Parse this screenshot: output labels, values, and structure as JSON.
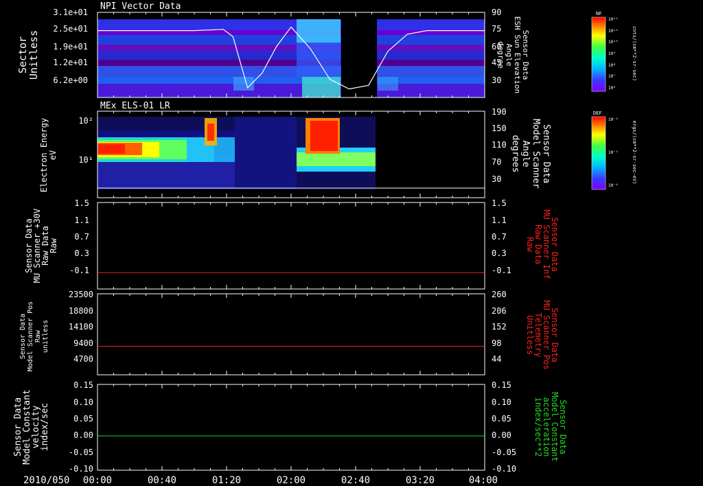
{
  "time_axis": {
    "date_label": "2010/050",
    "tick_labels": [
      "00:00",
      "00:40",
      "01:20",
      "02:00",
      "02:40",
      "03:20",
      "04:00"
    ],
    "range_hours": [
      0,
      4
    ],
    "data_gap_hours": [
      2.42,
      2.78
    ]
  },
  "colors": {
    "background": "#000000",
    "axis": "#ffffff",
    "red_trace": "#ff2020",
    "green_trace": "#22dd22"
  },
  "chart_data": [
    {
      "id": "npi",
      "type": "heatmap",
      "title": "NPI Vector Data",
      "ylabel_left": [
        "Sector",
        "Unitless"
      ],
      "ylabel_right": [
        "Sensor Data",
        "ESH Sun Elevation",
        "Angle",
        "degree"
      ],
      "y_ticks_left": [
        "3.1e+01",
        "2.5e+01",
        "1.9e+01",
        "1.2e+01",
        "6.2e+00"
      ],
      "y_ticks_right": [
        "90",
        "75",
        "60",
        "45",
        "30"
      ],
      "y_range_right": [
        20,
        90
      ],
      "colorbar": {
        "label": "NF",
        "units": "cnts/(cm**2-sr-sec)",
        "ticks": [
          "10¹²",
          "10¹¹",
          "10¹⁰",
          "10⁹",
          "10⁸",
          "10⁷",
          "10⁶"
        ]
      },
      "overlay_series": {
        "name": "",
        "x": [
          0,
          0.5,
          1.0,
          1.3,
          1.4,
          1.55,
          1.7,
          1.85,
          2.0,
          2.2,
          2.4,
          2.6,
          2.8,
          3.0,
          3.2,
          3.4,
          4.0
        ],
        "y": [
          75,
          75,
          75,
          76,
          70,
          28,
          40,
          62,
          78,
          60,
          35,
          27,
          30,
          58,
          72,
          75,
          75
        ]
      }
    },
    {
      "id": "els",
      "type": "heatmap",
      "title": "MEx ELS-01 LR",
      "ylabel_left": [
        "Electron Energy",
        "eV"
      ],
      "ylabel_right": [
        "Sensor Data",
        "Model Scanner",
        "Angle",
        "degrees"
      ],
      "y_ticks_left": [
        "10²",
        "10¹"
      ],
      "y_ticks_right": [
        "190",
        "150",
        "110",
        "70",
        "30"
      ],
      "colorbar": {
        "label": "DEF",
        "units": "ergs/(cm**2-sr-sec-eV)",
        "ticks": [
          "10⁻⁴",
          "10⁻⁵",
          "10⁻⁶"
        ]
      }
    },
    {
      "id": "mu30",
      "type": "line",
      "ylabel_left": [
        "Sensor Data",
        "MU Scanner +30V",
        "Raw Data",
        "Raw"
      ],
      "ylabel_right": [
        "Sensor Data",
        "MU Scanner Inf",
        "Raw Data",
        "Raw"
      ],
      "y_ticks_left": [
        "1.5",
        "1.1",
        "0.7",
        "0.3",
        "-0.1"
      ],
      "y_ticks_right": [
        "1.5",
        "1.1",
        "0.7",
        "0.3",
        "-0.1"
      ],
      "ylim": [
        -0.35,
        1.5
      ],
      "series": [
        {
          "name": "",
          "color": "#ff2020",
          "x": [
            0,
            4
          ],
          "y": [
            0.0,
            0.0
          ]
        }
      ]
    },
    {
      "id": "pos",
      "type": "line",
      "ylabel_left": [
        "Sensor Data",
        "Model Scanner Pos",
        "Raw",
        "unitless"
      ],
      "ylabel_right": [
        "Sensor Data",
        "MU Scanner Pos",
        "Telemetry",
        "Unitless"
      ],
      "y_ticks_left": [
        "23500",
        "18800",
        "14100",
        "9400",
        "4700"
      ],
      "y_ticks_right": [
        "260",
        "206",
        "152",
        "98",
        "44"
      ],
      "ylim": [
        0,
        23500
      ],
      "series": [
        {
          "name": "",
          "color": "#ff2020",
          "x": [
            0,
            4
          ],
          "y": [
            8300,
            8300
          ]
        }
      ]
    },
    {
      "id": "vel",
      "type": "line",
      "ylabel_left": [
        "Sensor Data",
        "Model Constant",
        "velocity",
        "index/sec"
      ],
      "ylabel_right": [
        "Sensor Data",
        "Model Constant",
        "acceleration",
        "index/sec**2"
      ],
      "y_ticks_left": [
        "0.15",
        "0.10",
        "0.05",
        "0.00",
        "-0.05",
        "-0.10"
      ],
      "y_ticks_right": [
        "0.15",
        "0.10",
        "0.05",
        "0.00",
        "-0.05",
        "-0.10"
      ],
      "ylim": [
        -0.1,
        0.15
      ],
      "series": [
        {
          "name": "",
          "color": "#22dd22",
          "x": [
            0,
            4
          ],
          "y": [
            0.0,
            0.0
          ]
        }
      ]
    }
  ]
}
